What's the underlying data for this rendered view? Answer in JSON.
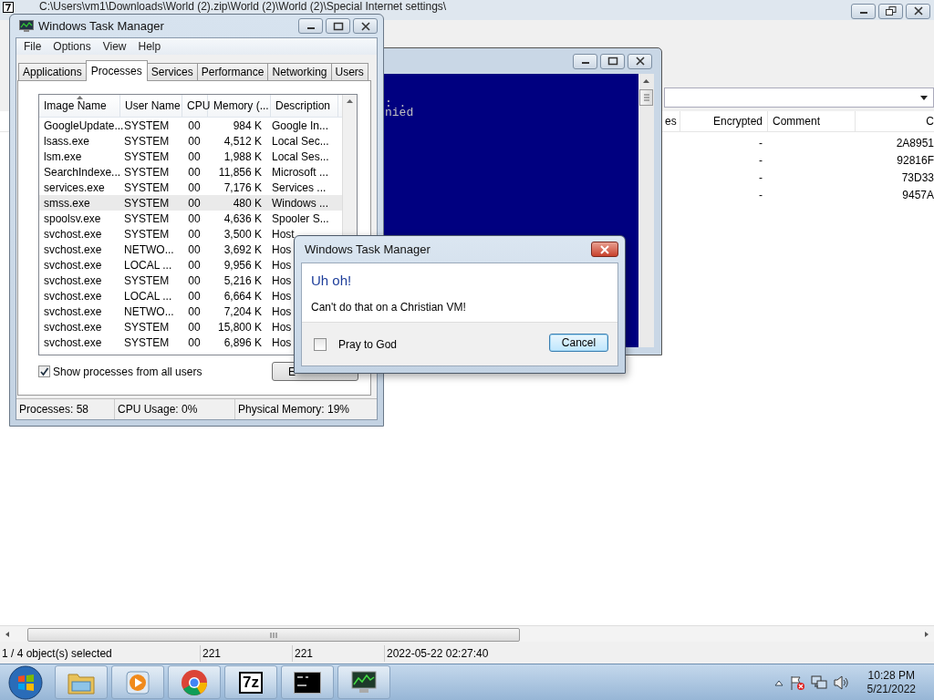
{
  "explorer": {
    "title": "C:\\Users\\vm1\\Downloads\\World (2).zip\\World (2)\\World (2)\\Special Internet settings\\",
    "columns": [
      "es",
      "Encrypted",
      "Comment",
      "C"
    ],
    "rows": [
      {
        "encrypted": "-",
        "crc": "2A8951"
      },
      {
        "encrypted": "-",
        "crc": "92816F"
      },
      {
        "encrypted": "-",
        "crc": "73D33"
      },
      {
        "encrypted": "-",
        "crc": "9457A"
      }
    ],
    "status": [
      "1 / 4 object(s) selected",
      "221",
      "221",
      "2022-05-22 02:27:40"
    ]
  },
  "console": {
    "lines": [
      ": .",
      "nied"
    ]
  },
  "task_manager": {
    "title": "Windows Task Manager",
    "menu": [
      "File",
      "Options",
      "View",
      "Help"
    ],
    "tabs": [
      {
        "label": "Applications",
        "selected": false
      },
      {
        "label": "Processes",
        "selected": true
      },
      {
        "label": "Services",
        "selected": false
      },
      {
        "label": "Performance",
        "selected": false
      },
      {
        "label": "Networking",
        "selected": false
      },
      {
        "label": "Users",
        "selected": false
      }
    ],
    "columns": [
      {
        "label": "Image Name",
        "sorted": true
      },
      {
        "label": "User Name",
        "sorted": false
      },
      {
        "label": "CPU",
        "sorted": false
      },
      {
        "label": "Memory (...",
        "sorted": false
      },
      {
        "label": "Description",
        "sorted": false
      }
    ],
    "rows": [
      {
        "cells": [
          "GoogleUpdate...",
          "SYSTEM",
          "00",
          "984 K",
          "Google In..."
        ],
        "selected": false
      },
      {
        "cells": [
          "lsass.exe",
          "SYSTEM",
          "00",
          "4,512 K",
          "Local Sec..."
        ],
        "selected": false
      },
      {
        "cells": [
          "lsm.exe",
          "SYSTEM",
          "00",
          "1,988 K",
          "Local Ses..."
        ],
        "selected": false
      },
      {
        "cells": [
          "SearchIndexe...",
          "SYSTEM",
          "00",
          "11,856 K",
          "Microsoft ..."
        ],
        "selected": false
      },
      {
        "cells": [
          "services.exe",
          "SYSTEM",
          "00",
          "7,176 K",
          "Services ..."
        ],
        "selected": false
      },
      {
        "cells": [
          "smss.exe",
          "SYSTEM",
          "00",
          "480 K",
          "Windows ..."
        ],
        "selected": true
      },
      {
        "cells": [
          "spoolsv.exe",
          "SYSTEM",
          "00",
          "4,636 K",
          "Spooler S..."
        ],
        "selected": false
      },
      {
        "cells": [
          "svchost.exe",
          "SYSTEM",
          "00",
          "3,500 K",
          "Host"
        ],
        "selected": false
      },
      {
        "cells": [
          "svchost.exe",
          "NETWO...",
          "00",
          "3,692 K",
          "Hos"
        ],
        "selected": false
      },
      {
        "cells": [
          "svchost.exe",
          "LOCAL ...",
          "00",
          "9,956 K",
          "Hos"
        ],
        "selected": false
      },
      {
        "cells": [
          "svchost.exe",
          "SYSTEM",
          "00",
          "5,216 K",
          "Hos"
        ],
        "selected": false
      },
      {
        "cells": [
          "svchost.exe",
          "LOCAL ...",
          "00",
          "6,664 K",
          "Hos"
        ],
        "selected": false
      },
      {
        "cells": [
          "svchost.exe",
          "NETWO...",
          "00",
          "7,204 K",
          "Hos"
        ],
        "selected": false
      },
      {
        "cells": [
          "svchost.exe",
          "SYSTEM",
          "00",
          "15,800 K",
          "Hos"
        ],
        "selected": false
      },
      {
        "cells": [
          "svchost.exe",
          "SYSTEM",
          "00",
          "6,896 K",
          "Hos"
        ],
        "selected": false
      }
    ],
    "show_all": {
      "label": "Show processes from all users",
      "checked": true
    },
    "end_button": "E",
    "status": [
      "Processes: 58",
      "CPU Usage: 0%",
      "Physical Memory: 19%"
    ]
  },
  "dialog": {
    "title": "Windows Task Manager",
    "heading": "Uh oh!",
    "message": "Can't do that on a Christian VM!",
    "checkbox": {
      "label": "Pray to God",
      "checked": false
    },
    "button": "Cancel"
  },
  "taskbar": {
    "apps": [
      {
        "kind": "folder"
      },
      {
        "kind": "media"
      },
      {
        "kind": "browser"
      },
      {
        "kind": "archiver",
        "label": "7z"
      },
      {
        "kind": "terminal"
      },
      {
        "kind": "monitor"
      }
    ],
    "time": "10:28 PM",
    "date": "5/21/2022"
  }
}
